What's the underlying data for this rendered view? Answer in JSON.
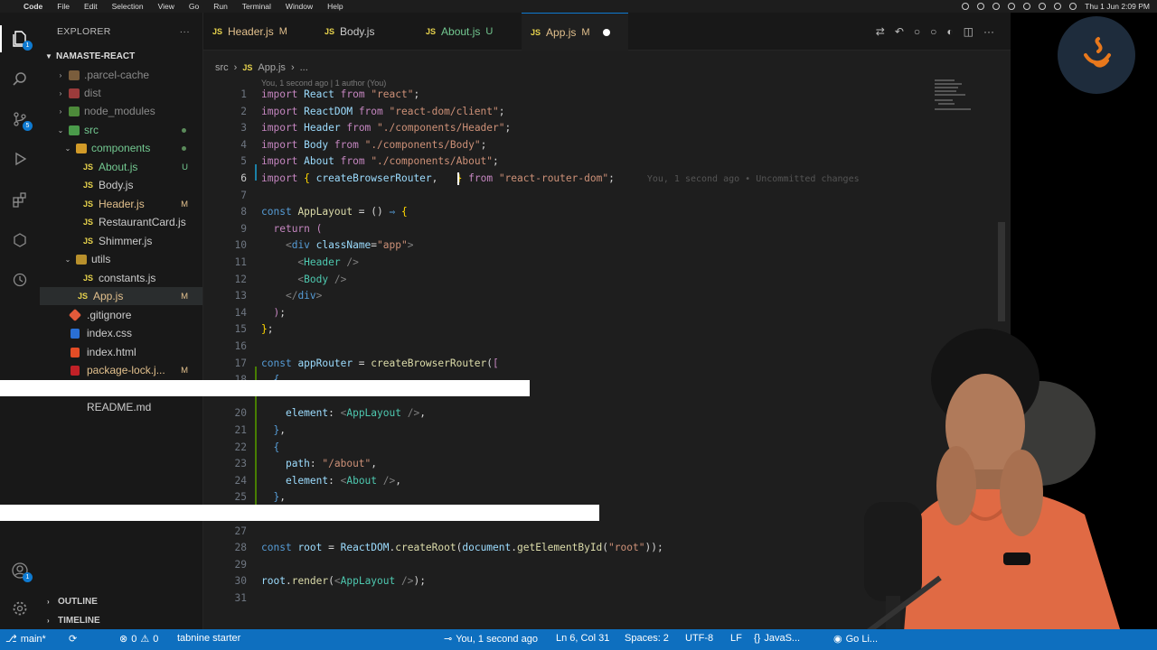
{
  "menubar": {
    "app": "Code",
    "items": [
      "File",
      "Edit",
      "Selection",
      "View",
      "Go",
      "Run",
      "Terminal",
      "Window",
      "Help"
    ],
    "clock": "Thu 1 Jun  2:09 PM"
  },
  "activity": {
    "explorer_badge": "1",
    "scm_badge": "5",
    "account_badge": "1"
  },
  "sidebar": {
    "title": "EXPLORER",
    "project": "NAMASTE-REACT",
    "tree": [
      {
        "label": ".parcel-cache",
        "type": "folder"
      },
      {
        "label": "dist",
        "type": "folder"
      },
      {
        "label": "node_modules",
        "type": "folder"
      },
      {
        "label": "src",
        "type": "folder-open"
      },
      {
        "label": "components",
        "type": "folder-open"
      },
      {
        "label": "About.js",
        "status": "U"
      },
      {
        "label": "Body.js",
        "status": ""
      },
      {
        "label": "Header.js",
        "status": "M"
      },
      {
        "label": "RestaurantCard.js",
        "status": ""
      },
      {
        "label": "Shimmer.js",
        "status": ""
      },
      {
        "label": "utils",
        "type": "folder-open"
      },
      {
        "label": "constants.js",
        "status": ""
      },
      {
        "label": "App.js",
        "status": "M"
      },
      {
        "label": ".gitignore",
        "status": ""
      },
      {
        "label": "index.css",
        "status": ""
      },
      {
        "label": "index.html",
        "status": ""
      },
      {
        "label": "package-lock.j...",
        "status": "M"
      },
      {
        "label": "README.md",
        "status": ""
      }
    ],
    "outline": "OUTLINE",
    "timeline": "TIMELINE"
  },
  "tabs": [
    {
      "label": "Header.js",
      "status": "M"
    },
    {
      "label": "Body.js",
      "status": ""
    },
    {
      "label": "About.js",
      "status": "U"
    },
    {
      "label": "App.js",
      "status": "M"
    }
  ],
  "breadcrumb": {
    "folder": "src",
    "file": "App.js",
    "more": "..."
  },
  "blame": "You, 1 second ago | 1 author (You)",
  "inline_blame": "You, 1 second ago • Uncommitted changes",
  "editor": {
    "lines": [
      {
        "n": "1"
      },
      {
        "n": "2"
      },
      {
        "n": "3"
      },
      {
        "n": "4"
      },
      {
        "n": "5"
      },
      {
        "n": "6"
      },
      {
        "n": "7"
      },
      {
        "n": "8"
      },
      {
        "n": "9"
      },
      {
        "n": "10"
      },
      {
        "n": "11"
      },
      {
        "n": "12"
      },
      {
        "n": "13"
      },
      {
        "n": "14"
      },
      {
        "n": "15"
      },
      {
        "n": "16"
      },
      {
        "n": "17"
      },
      {
        "n": "18"
      },
      {
        "n": "20"
      },
      {
        "n": "21"
      },
      {
        "n": "22"
      },
      {
        "n": "23"
      },
      {
        "n": "24"
      },
      {
        "n": "25"
      },
      {
        "n": "27"
      },
      {
        "n": "28"
      },
      {
        "n": "29"
      },
      {
        "n": "30"
      },
      {
        "n": "31"
      }
    ]
  },
  "statusbar": {
    "branch": "main*",
    "errors": "0",
    "warnings": "0",
    "tabnine": "tabnine starter",
    "blame": "You, 1 second ago",
    "position": "Ln 6, Col 31",
    "spaces": "Spaces: 2",
    "encoding": "UTF-8",
    "eol": "LF",
    "language": "JavaS...",
    "golive": "Go Li..."
  }
}
